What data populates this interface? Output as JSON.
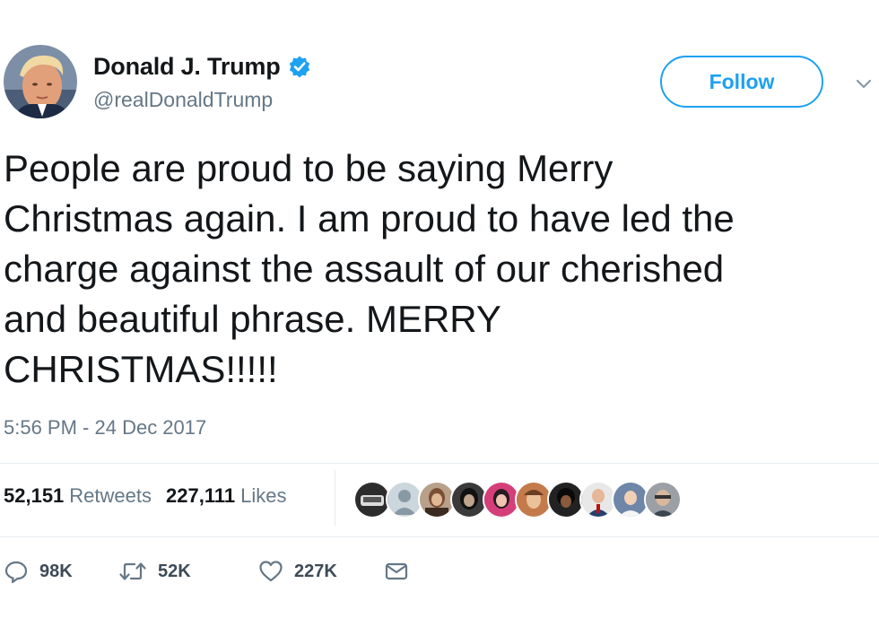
{
  "author": {
    "display_name": "Donald J. Trump",
    "handle": "@realDonaldTrump",
    "verified": true
  },
  "follow_button": {
    "label": "Follow"
  },
  "tweet": {
    "text": "People are proud to be saying Merry\nChristmas again. I am proud to have led the\ncharge against the assault of our cherished\nand beautiful phrase. MERRY\nCHRISTMAS!!!!!",
    "timestamp": "5:56 PM - 24 Dec 2017"
  },
  "stats": {
    "retweets_count": "52,151",
    "retweets_label": "Retweets",
    "likes_count": "227,111",
    "likes_label": "Likes"
  },
  "actions": {
    "reply_count": "98K",
    "retweet_count": "52K",
    "like_count": "227K"
  },
  "colors": {
    "accent": "#1da1f2",
    "secondary_text": "#657786",
    "divider": "#e6ecf0"
  },
  "icons": [
    "verified-badge-icon",
    "chevron-down-icon",
    "reply-icon",
    "retweet-icon",
    "like-icon",
    "direct-message-icon"
  ]
}
